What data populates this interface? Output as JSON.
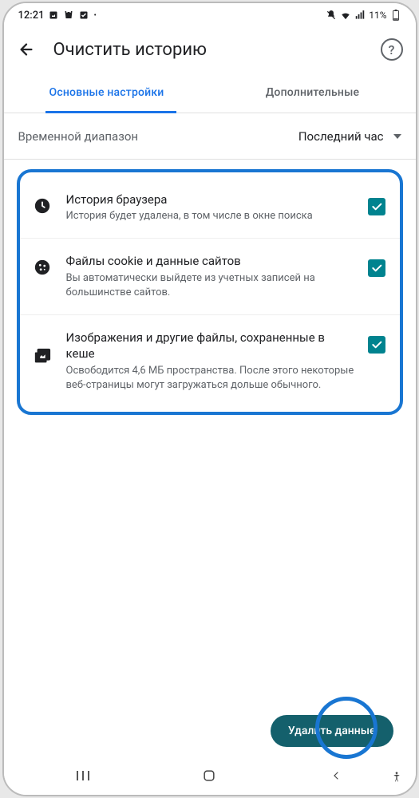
{
  "status_bar": {
    "time": "12:21",
    "battery": "11%"
  },
  "app_bar": {
    "title": "Очистить историю",
    "help_symbol": "?"
  },
  "tabs": {
    "basic": "Основные настройки",
    "advanced": "Дополнительные"
  },
  "range": {
    "label": "Временной диапазон",
    "selected": "Последний час"
  },
  "items": [
    {
      "title": "История браузера",
      "desc": "История будет удалена, в том числе в окне поиска"
    },
    {
      "title": "Файлы cookie и данные сайтов",
      "desc": "Вы автоматически выйдете из учетных записей на большинстве сайтов."
    },
    {
      "title": "Изображения и другие файлы, сохраненные в кеше",
      "desc": "Освободится 4,6 МБ пространства. После этого некоторые веб-страницы могут загружаться дольше обычного."
    }
  ],
  "action": {
    "label": "Удалить данные"
  }
}
